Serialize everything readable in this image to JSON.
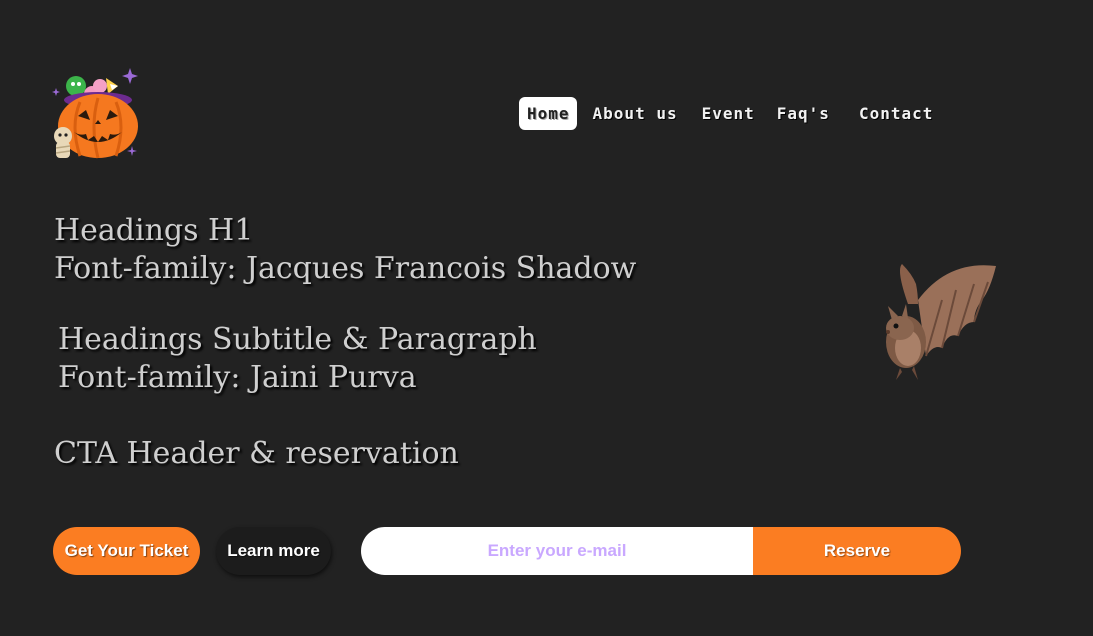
{
  "nav": {
    "items": [
      {
        "label": "Home",
        "active": true
      },
      {
        "label": "About us",
        "active": false
      },
      {
        "label": "Event",
        "active": false
      },
      {
        "label": "Faq's",
        "active": false
      },
      {
        "label": "Contact",
        "active": false
      }
    ]
  },
  "typography": {
    "h1_line1": "Headings H1",
    "h1_line2": "Font-family: Jacques Francois Shadow",
    "sub_line1": "Headings Subtitle & Paragraph",
    "sub_line2": "Font-family: Jaini Purva",
    "cta_line": "CTA Header & reservation"
  },
  "cta": {
    "ticket_label": "Get Your Ticket",
    "learn_label": "Learn more"
  },
  "reservation": {
    "email_placeholder": "Enter your e-mail",
    "reserve_label": "Reserve"
  },
  "colors": {
    "background": "#222222",
    "accent_orange": "#fb7d22",
    "placeholder_purple": "#c9a8ff",
    "text_light": "#cfcfcf"
  },
  "icons": {
    "logo": "pumpkin-candy-basket-icon",
    "decoration": "bat-icon"
  }
}
